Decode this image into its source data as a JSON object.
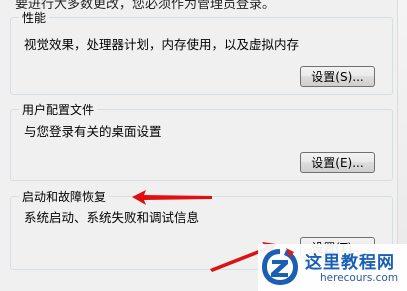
{
  "intro_text": "要进行大多数更改，您必须作为管理员登录。",
  "groups": [
    {
      "title": "性能",
      "description": "视觉效果，处理器计划，内存使用，以及虚拟内存",
      "button_label": "设置(S)..."
    },
    {
      "title": "用户配置文件",
      "description": "与您登录有关的桌面设置",
      "button_label": "设置(E)..."
    },
    {
      "title": "启动和故障恢复",
      "description": "系统启动、系统失败和调试信息",
      "button_label": "设置(T)..."
    }
  ],
  "annotation": {
    "arrow_color": "#e01010"
  },
  "watermark": {
    "title": "这里教程网",
    "url": "herecours.com",
    "icon": "z-logo-icon",
    "colors": {
      "brand_blue": "#1a5fb4",
      "brand_red": "#d42020"
    }
  }
}
